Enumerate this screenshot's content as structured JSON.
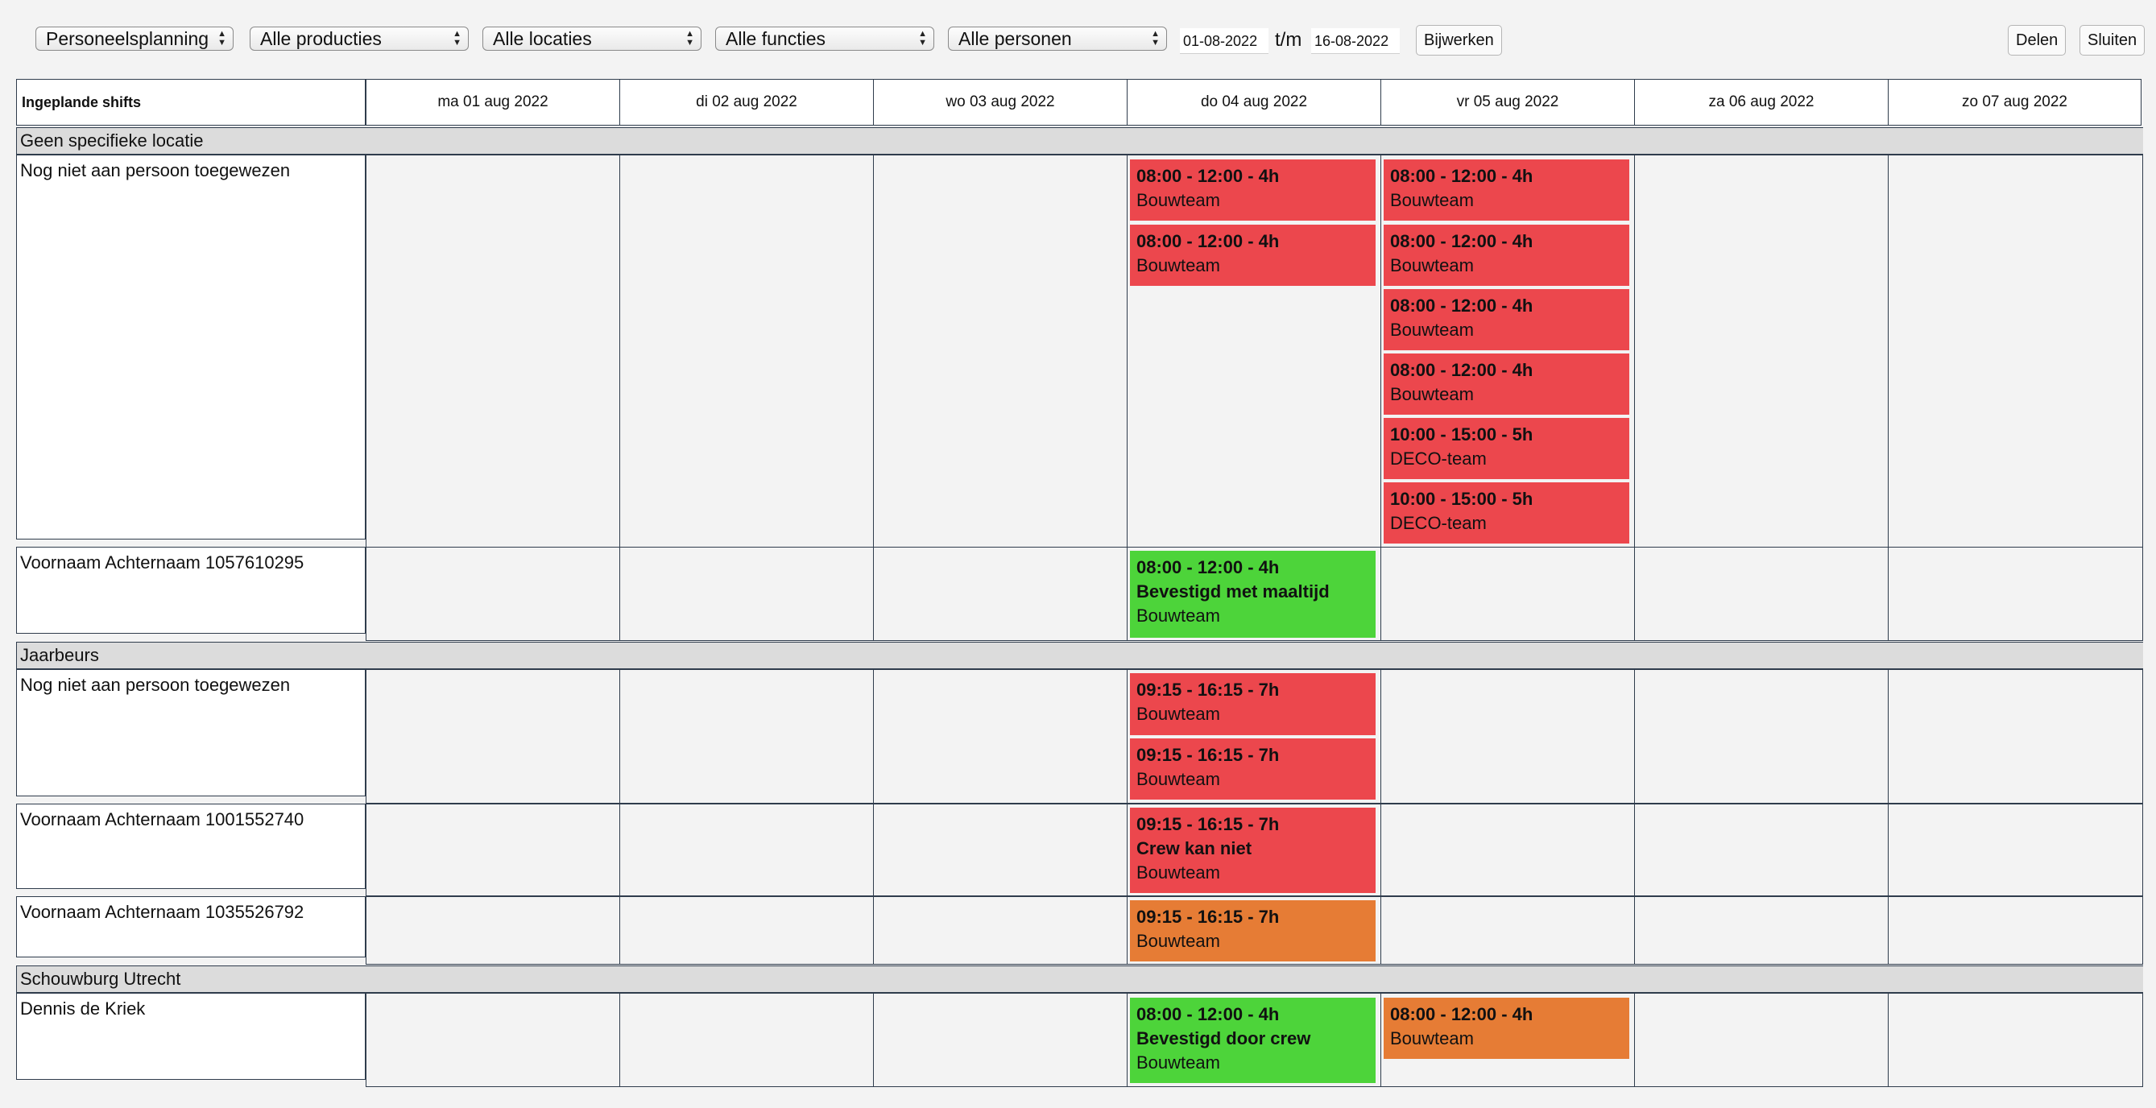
{
  "toolbar": {
    "planning": "Personeelsplanning",
    "productions": "Alle producties",
    "locations": "Alle locaties",
    "functions": "Alle functies",
    "persons": "Alle personen",
    "date_from": "01-08-2022",
    "tm": "t/m",
    "date_to": "16-08-2022",
    "update": "Bijwerken",
    "share": "Delen",
    "close": "Sluiten"
  },
  "grid": {
    "corner": "Ingeplande shifts",
    "days": [
      "ma 01 aug 2022",
      "di 02 aug 2022",
      "wo 03 aug 2022",
      "do 04 aug 2022",
      "vr 05 aug 2022",
      "za 06 aug 2022",
      "zo 07 aug 2022"
    ],
    "locations": [
      {
        "name": "Geen specifieke locatie"
      },
      {
        "name": "Jaarbeurs"
      },
      {
        "name": "Schouwburg Utrecht"
      }
    ],
    "rows": [
      {
        "name": "Nog niet aan persoon toegewezen"
      },
      {
        "name": "Voornaam Achternaam 1057610295"
      },
      {
        "name": "Nog niet aan persoon toegewezen"
      },
      {
        "name": "Voornaam Achternaam 1001552740"
      },
      {
        "name": "Voornaam Achternaam 1035526792"
      },
      {
        "name": "Dennis de Kriek"
      }
    ],
    "shifts": [
      {
        "time": "08:00 - 12:00 - 4h",
        "status": "",
        "group": "Bouwteam",
        "color": "#ec474d"
      },
      {
        "time": "08:00 - 12:00 - 4h",
        "status": "",
        "group": "Bouwteam",
        "color": "#ec474d"
      },
      {
        "time": "08:00 - 12:00 - 4h",
        "status": "",
        "group": "Bouwteam",
        "color": "#ec474d"
      },
      {
        "time": "08:00 - 12:00 - 4h",
        "status": "",
        "group": "Bouwteam",
        "color": "#ec474d"
      },
      {
        "time": "08:00 - 12:00 - 4h",
        "status": "",
        "group": "Bouwteam",
        "color": "#ec474d"
      },
      {
        "time": "08:00 - 12:00 - 4h",
        "status": "",
        "group": "Bouwteam",
        "color": "#ec474d"
      },
      {
        "time": "10:00 - 15:00 - 5h",
        "status": "",
        "group": "DECO-team",
        "color": "#ec474d"
      },
      {
        "time": "10:00 - 15:00 - 5h",
        "status": "",
        "group": "DECO-team",
        "color": "#ec474d"
      },
      {
        "time": "08:00 - 12:00 - 4h",
        "status": "Bevestigd met maaltijd",
        "group": "Bouwteam",
        "color": "#4dd43a"
      },
      {
        "time": "09:15 - 16:15 - 7h",
        "status": "",
        "group": "Bouwteam",
        "color": "#ec474d"
      },
      {
        "time": "09:15 - 16:15 - 7h",
        "status": "",
        "group": "Bouwteam",
        "color": "#ec474d"
      },
      {
        "time": "09:15 - 16:15 - 7h",
        "status": "Crew kan niet",
        "group": "Bouwteam",
        "color": "#ec474d"
      },
      {
        "time": "09:15 - 16:15 - 7h",
        "status": "",
        "group": "Bouwteam",
        "color": "#e67c35"
      },
      {
        "time": "08:00 - 12:00 - 4h",
        "status": "Bevestigd door crew",
        "group": "Bouwteam",
        "color": "#4dd43a"
      },
      {
        "time": "08:00 - 12:00 - 4h",
        "status": "",
        "group": "Bouwteam",
        "color": "#e67c35"
      }
    ]
  }
}
